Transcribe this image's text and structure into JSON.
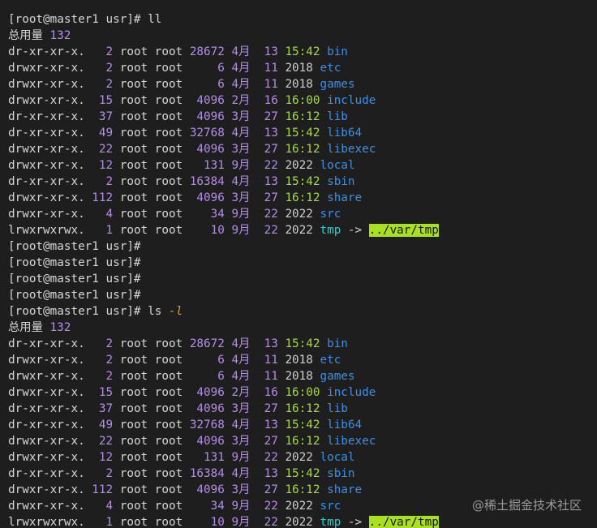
{
  "colors": {
    "background": "#1e1e1e",
    "default_text": "#d6d6d6",
    "number": "#b38de8",
    "time": "#a8d93a",
    "directory": "#3b8fe8",
    "symlink": "#36c7c7",
    "symlink_target_bg": "#a9e022",
    "cursor": "#f2a900"
  },
  "prompt": "[root@master1 usr]#",
  "total_label": "总用量",
  "total_value": "132",
  "commands": {
    "first": " ll",
    "second_cmd": " ls ",
    "second_flag": "-l"
  },
  "listing": [
    {
      "perm": "dr-xr-xr-x.",
      "links": "  2",
      "owner": "root",
      "group": "root",
      "size": "28672",
      "month": "4月",
      "day": "13",
      "time": "15:42",
      "name": "bin",
      "target": ""
    },
    {
      "perm": "drwxr-xr-x.",
      "links": "  2",
      "owner": "root",
      "group": "root",
      "size": "    6",
      "month": "4月",
      "day": "11",
      "time": "2018",
      "name": "etc",
      "target": ""
    },
    {
      "perm": "drwxr-xr-x.",
      "links": "  2",
      "owner": "root",
      "group": "root",
      "size": "    6",
      "month": "4月",
      "day": "11",
      "time": "2018",
      "name": "games",
      "target": ""
    },
    {
      "perm": "drwxr-xr-x.",
      "links": " 15",
      "owner": "root",
      "group": "root",
      "size": " 4096",
      "month": "2月",
      "day": "16",
      "time": "16:00",
      "name": "include",
      "target": ""
    },
    {
      "perm": "dr-xr-xr-x.",
      "links": " 37",
      "owner": "root",
      "group": "root",
      "size": " 4096",
      "month": "3月",
      "day": "27",
      "time": "16:12",
      "name": "lib",
      "target": ""
    },
    {
      "perm": "dr-xr-xr-x.",
      "links": " 49",
      "owner": "root",
      "group": "root",
      "size": "32768",
      "month": "4月",
      "day": "13",
      "time": "15:42",
      "name": "lib64",
      "target": ""
    },
    {
      "perm": "drwxr-xr-x.",
      "links": " 22",
      "owner": "root",
      "group": "root",
      "size": " 4096",
      "month": "3月",
      "day": "27",
      "time": "16:12",
      "name": "libexec",
      "target": ""
    },
    {
      "perm": "drwxr-xr-x.",
      "links": " 12",
      "owner": "root",
      "group": "root",
      "size": "  131",
      "month": "9月",
      "day": "22",
      "time": "2022",
      "name": "local",
      "target": ""
    },
    {
      "perm": "dr-xr-xr-x.",
      "links": "  2",
      "owner": "root",
      "group": "root",
      "size": "16384",
      "month": "4月",
      "day": "13",
      "time": "15:42",
      "name": "sbin",
      "target": ""
    },
    {
      "perm": "drwxr-xr-x.",
      "links": "112",
      "owner": "root",
      "group": "root",
      "size": " 4096",
      "month": "3月",
      "day": "27",
      "time": "16:12",
      "name": "share",
      "target": ""
    },
    {
      "perm": "drwxr-xr-x.",
      "links": "  4",
      "owner": "root",
      "group": "root",
      "size": "   34",
      "month": "9月",
      "day": "22",
      "time": "2022",
      "name": "src",
      "target": ""
    },
    {
      "perm": "lrwxrwxrwx.",
      "links": "  1",
      "owner": "root",
      "group": "root",
      "size": "   10",
      "month": "9月",
      "day": "22",
      "time": "2022",
      "name": "tmp",
      "target": "../var/tmp"
    }
  ],
  "arrow": "->",
  "watermark": "@稀土掘金技术社区"
}
